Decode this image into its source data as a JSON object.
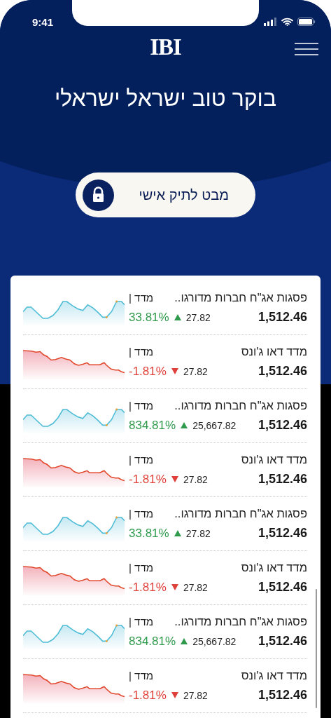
{
  "status_bar": {
    "time": "9:41"
  },
  "header": {
    "logo": "IBI",
    "greeting": "בוקר טוב ישראל ישראלי"
  },
  "portfolio_button": {
    "label": "מבט לתיק אישי"
  },
  "indices": [
    {
      "kind": "up",
      "name": "פסגות אג\"ח חברות מדורגו..",
      "tag": "מדד |",
      "value": "1,512.46",
      "change": "27.82",
      "percent": "33.81%"
    },
    {
      "kind": "down",
      "name": "מדד דאו ג'ונס",
      "tag": "מדד |",
      "value": "1,512.46",
      "change": "27.82",
      "percent": "-1.81%"
    },
    {
      "kind": "up",
      "name": "פסגות אג\"ח חברות מדורגו..",
      "tag": "מדד |",
      "value": "1,512.46",
      "change": "25,667.82",
      "percent": "834.81%"
    },
    {
      "kind": "down",
      "name": "מדד דאו ג'ונס",
      "tag": "מדד |",
      "value": "1,512.46",
      "change": "27.82",
      "percent": "-1.81%"
    },
    {
      "kind": "up",
      "name": "פסגות אג\"ח חברות מדורגו..",
      "tag": "מדד |",
      "value": "1,512.46",
      "change": "27.82",
      "percent": "33.81%"
    },
    {
      "kind": "down",
      "name": "מדד דאו ג'ונס",
      "tag": "מדד |",
      "value": "1,512.46",
      "change": "27.82",
      "percent": "-1.81%"
    },
    {
      "kind": "up",
      "name": "פסגות אג\"ח חברות מדורגו..",
      "tag": "מדד |",
      "value": "1,512.46",
      "change": "25,667.82",
      "percent": "834.81%"
    },
    {
      "kind": "down",
      "name": "מדד דאו ג'ונס",
      "tag": "מדד |",
      "value": "1,512.46",
      "change": "27.82",
      "percent": "-1.81%"
    }
  ]
}
